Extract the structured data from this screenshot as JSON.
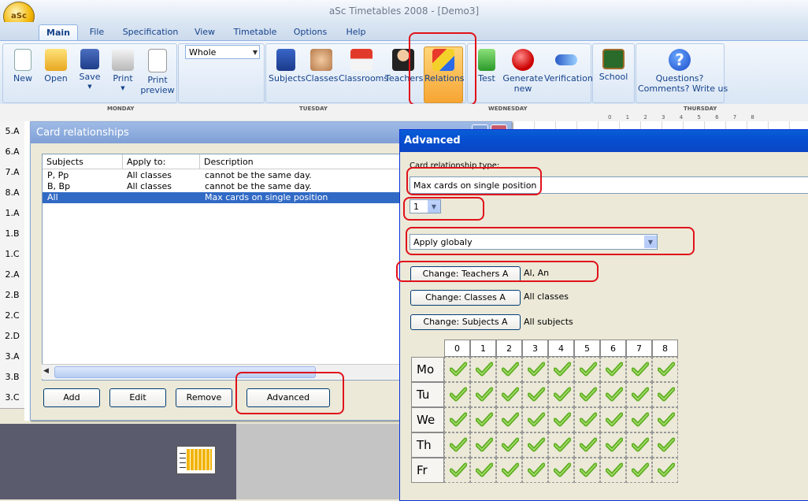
{
  "window": {
    "title": "aSc Timetables 2008  - [Demo3]",
    "logo_text": "aSc"
  },
  "menu": {
    "tabs": [
      "Main",
      "File",
      "Specification",
      "View",
      "Timetable",
      "Options",
      "Help"
    ],
    "active": "Main"
  },
  "ribbon": {
    "new": "New",
    "open": "Open",
    "save": "Save",
    "print": "Print",
    "print_preview_1": "Print",
    "print_preview_2": "preview",
    "view_select": "Whole",
    "subjects": "Subjects",
    "classes": "Classes",
    "classrooms": "Classrooms",
    "teachers": "Teachers",
    "relations": "Relations",
    "test": "Test",
    "generate_1": "Generate",
    "generate_2": "new",
    "verification": "Verification",
    "school": "School",
    "questions_1": "Questions?",
    "questions_2": "Comments? Write us"
  },
  "timetable": {
    "days": [
      "MONDAY",
      "TUESDAY",
      "WEDNESDAY",
      "THURSDAY"
    ],
    "periods": "0  1  2  3  4  5  6  7  8",
    "rows": [
      "5.A",
      "6.A",
      "7.A",
      "8.A",
      "1.A",
      "1.B",
      "1.C",
      "2.A",
      "2.B",
      "2.C",
      "2.D",
      "3.A",
      "3.B",
      "3.C"
    ]
  },
  "card_relationships": {
    "title": "Card relationships",
    "columns": [
      "Subjects",
      "Apply to:",
      "Description"
    ],
    "rows": [
      {
        "subjects": "P, Pp",
        "apply_to": "All classes",
        "description": "cannot be the same day."
      },
      {
        "subjects": "B, Bp",
        "apply_to": "All classes",
        "description": "cannot be the same day."
      },
      {
        "subjects": "All",
        "apply_to": "",
        "description": "Max cards on single position"
      }
    ],
    "buttons": {
      "add": "Add",
      "edit": "Edit",
      "remove": "Remove",
      "advanced": "Advanced"
    }
  },
  "advanced": {
    "title": "Advanced",
    "type_label": "Card relationship type:",
    "type_value": "Max cards on single position",
    "count_value": "1",
    "scope_value": "Apply globaly",
    "change_teachers": "Change: Teachers A",
    "teachers_value": "Al, An",
    "change_classes": "Change: Classes A",
    "classes_value": "All classes",
    "change_subjects": "Change: Subjects A",
    "subjects_value": "All subjects",
    "grid_periods": [
      "0",
      "1",
      "2",
      "3",
      "4",
      "5",
      "6",
      "7",
      "8"
    ],
    "grid_days": [
      "Mo",
      "Tu",
      "We",
      "Th",
      "Fr"
    ],
    "check_color": "#5fae22"
  }
}
